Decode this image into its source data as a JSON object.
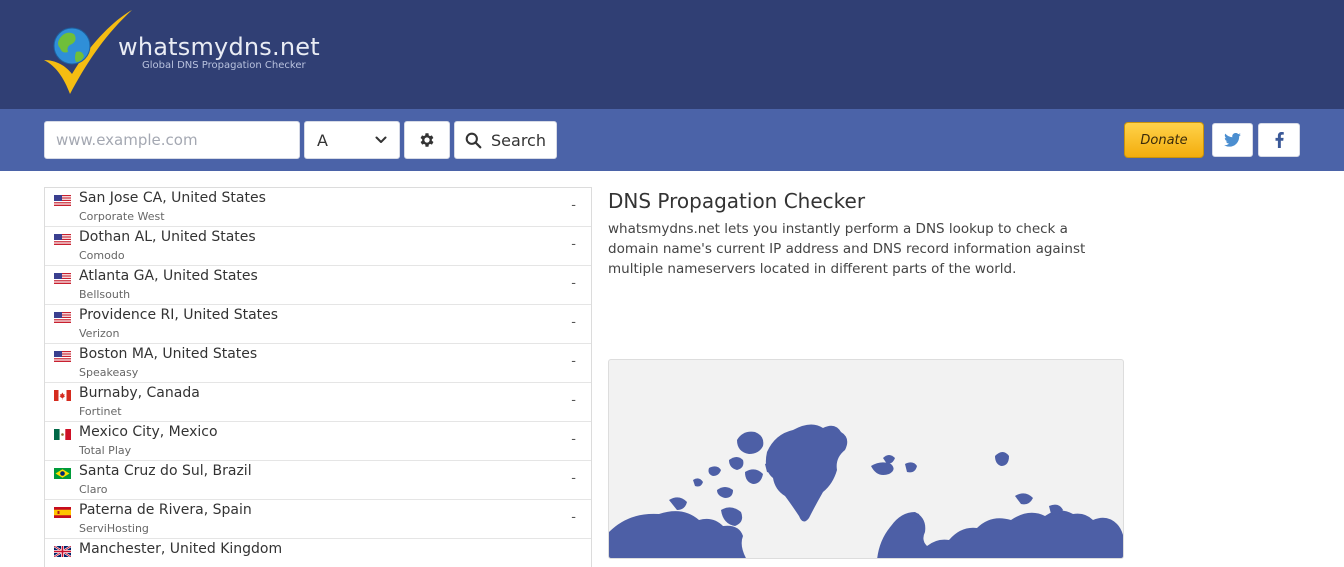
{
  "brand": {
    "name": "whatsmydns.net",
    "tagline": "Global DNS Propagation Checker",
    "colors": {
      "header": "#303f74",
      "toolbar": "#4b63a8",
      "accent": "#f5b516",
      "map_land": "#4d5fa6"
    }
  },
  "search": {
    "placeholder": "www.example.com",
    "value": "",
    "record_type": "A",
    "search_label": "Search"
  },
  "toolbar": {
    "donate_label": "Donate",
    "icons": {
      "settings": "gear-icon",
      "search": "magnifier-icon",
      "dropdown": "chevron-down-icon",
      "twitter": "twitter-icon",
      "facebook": "facebook-icon"
    }
  },
  "results": [
    {
      "flag": "us",
      "location": "San Jose CA, United States",
      "provider": "Corporate West",
      "result": "-"
    },
    {
      "flag": "us",
      "location": "Dothan AL, United States",
      "provider": "Comodo",
      "result": "-"
    },
    {
      "flag": "us",
      "location": "Atlanta GA, United States",
      "provider": "Bellsouth",
      "result": "-"
    },
    {
      "flag": "us",
      "location": "Providence RI, United States",
      "provider": "Verizon",
      "result": "-"
    },
    {
      "flag": "us",
      "location": "Boston MA, United States",
      "provider": "Speakeasy",
      "result": "-"
    },
    {
      "flag": "ca",
      "location": "Burnaby, Canada",
      "provider": "Fortinet",
      "result": "-"
    },
    {
      "flag": "mx",
      "location": "Mexico City, Mexico",
      "provider": "Total Play",
      "result": "-"
    },
    {
      "flag": "br",
      "location": "Santa Cruz do Sul, Brazil",
      "provider": "Claro",
      "result": "-"
    },
    {
      "flag": "es",
      "location": "Paterna de Rivera, Spain",
      "provider": "ServiHosting",
      "result": "-"
    },
    {
      "flag": "gb",
      "location": "Manchester, United Kingdom",
      "provider": "",
      "result": ""
    }
  ],
  "info": {
    "title": "DNS Propagation Checker",
    "description": "whatsmydns.net lets you instantly perform a DNS lookup to check a domain name's current IP address and DNS record information against multiple nameservers located in different parts of the world."
  }
}
